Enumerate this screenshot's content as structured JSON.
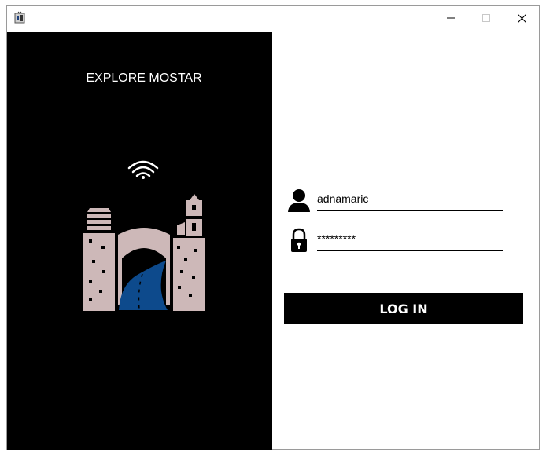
{
  "window": {
    "icon": "app-icon",
    "controls": [
      "minimize-icon",
      "maximize-icon",
      "close-icon"
    ]
  },
  "left_panel": {
    "title": "EXPLORE MOSTAR",
    "logo_icons": [
      "wifi-icon",
      "mostar-bridge-logo"
    ]
  },
  "login_form": {
    "username_value": "adnamaric",
    "password_value": "*********",
    "username_icon": "user-icon",
    "password_icon": "lock-icon",
    "login_label": "LOG IN"
  },
  "colors": {
    "panel_bg": "#000000",
    "logo_tower": "#cdb8b8",
    "logo_river": "#0d4a8c",
    "button_bg": "#000000",
    "button_text": "#ffffff"
  }
}
